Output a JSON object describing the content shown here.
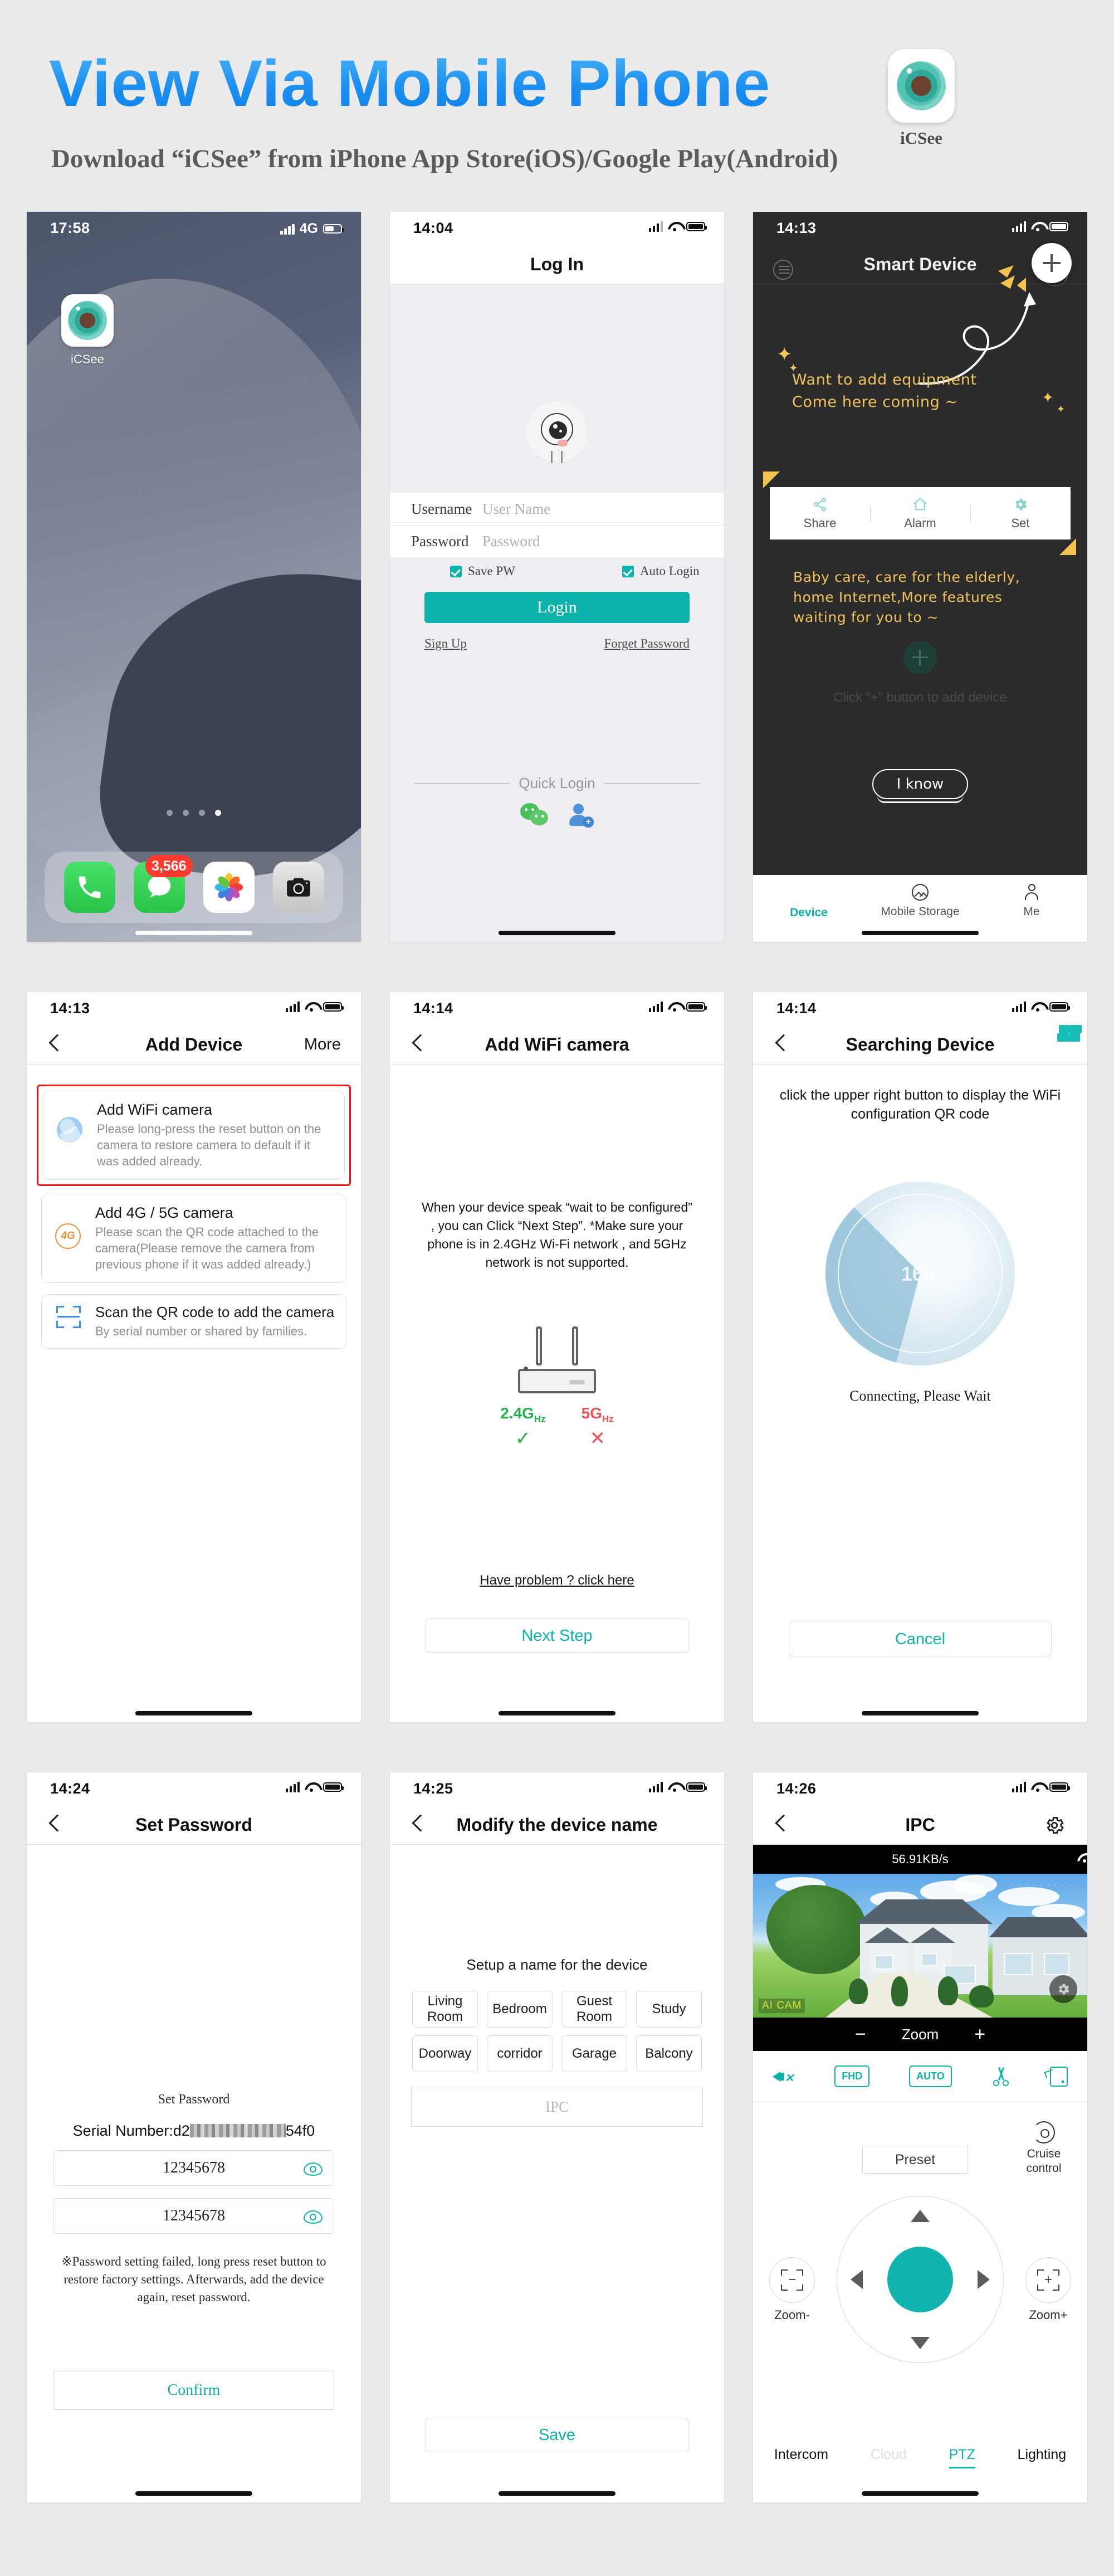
{
  "header": {
    "title": "View Via Mobile Phone",
    "subtitle": "Download “iCSee” from iPhone App Store(iOS)/Google Play(Android)",
    "app_name": "iCSee",
    "accent_blue": "#1b8ff0",
    "accent_teal": "#0bb3ab"
  },
  "screens": {
    "home": {
      "time": "17:58",
      "network": "4G",
      "app_label": "iCSee",
      "badge_count": "3,566",
      "dock": [
        "phone-icon",
        "messages-icon",
        "photos-icon",
        "camera-icon"
      ],
      "page_dots": 4,
      "active_dot": 4
    },
    "login": {
      "time": "14:04",
      "title": "Log In",
      "username_label": "Username",
      "username_placeholder": "User Name",
      "password_label": "Password",
      "password_placeholder": "Password",
      "save_pw": "Save PW",
      "auto_login": "Auto Login",
      "login_button": "Login",
      "sign_up": "Sign Up",
      "forget_password": "Forget Password",
      "quick_login": "Quick Login",
      "quick_icons": [
        "wechat-icon",
        "qq-icon"
      ]
    },
    "smart_device": {
      "time": "14:13",
      "title": "Smart Device",
      "hint_line1": "Want to add equipment",
      "hint_line2": "Come here coming ~",
      "quick_actions": [
        "Share",
        "Alarm",
        "Set"
      ],
      "hint2_line1": "Baby care, care for the elderly,",
      "hint2_line2": "home Internet,More features",
      "hint2_line3": "waiting for you to ~",
      "empty_hint": "Click “+” button to add device",
      "i_know": "I know",
      "tabs": [
        "Device",
        "Mobile Storage",
        "Me"
      ],
      "active_tab": "Device"
    },
    "add_device": {
      "time": "14:13",
      "title": "Add Device",
      "more": "More",
      "options": [
        {
          "title": "Add WiFi camera",
          "desc": "Please long-press the reset button on the camera to restore camera to default if it was added already.",
          "highlighted": true
        },
        {
          "title": "Add 4G / 5G camera",
          "desc": "Please scan the QR code attached to the camera(Please remove the camera from previous phone if it was added already.)",
          "highlighted": false
        },
        {
          "title": "Scan the QR code to add the camera",
          "desc": "By serial number or shared by families.",
          "highlighted": false
        }
      ]
    },
    "add_wifi": {
      "time": "14:14",
      "title": "Add WiFi camera",
      "paragraph": "When your device speak “wait to be configured” , you can Click “Next Step”. *Make sure your phone is in 2.4GHz Wi-Fi network , and 5GHz network is not supported.",
      "freq_ok_label": "2.4G",
      "freq_ok_unit": "Hz",
      "freq_ok_mark": "✓",
      "freq_no_label": "5G",
      "freq_no_unit": "Hz",
      "freq_no_mark": "✕",
      "have_problem": "Have problem ? click here",
      "next_step": "Next Step"
    },
    "searching": {
      "time": "14:14",
      "title": "Searching Device",
      "note": "click the upper right button to display the WiFi configuration QR code",
      "degrees": "166'",
      "status": "Connecting, Please Wait",
      "cancel": "Cancel"
    },
    "set_password": {
      "time": "14:24",
      "title": "Set Password",
      "section_title": "Set Password",
      "serial_prefix": "Serial Number:d2",
      "serial_suffix": "54f0",
      "password1": "12345678",
      "password2": "12345678",
      "warning": "※Password setting failed, long press reset button to restore factory settings. Afterwards, add the device again, reset password.",
      "confirm": "Confirm"
    },
    "modify_name": {
      "time": "14:25",
      "title": "Modify the device name",
      "prompt": "Setup a name for the device",
      "chips": [
        "Living Room",
        "Bedroom",
        "Guest Room",
        "Study",
        "Doorway",
        "corridor",
        "Garage",
        "Balcony"
      ],
      "name_placeholder": "IPC",
      "save": "Save"
    },
    "ipc": {
      "time": "14:26",
      "title": "IPC",
      "bitrate": "56.91KB/s",
      "watermark": "AI CAM",
      "zoom_label": "Zoom",
      "zoom_minus": "−",
      "zoom_plus": "+",
      "tools": [
        "mute-icon",
        "FHD",
        "AUTO",
        "scissors-icon",
        "snapshot-icon"
      ],
      "preset": "Preset",
      "cruise_line1": "Cruise",
      "cruise_line2": "control",
      "zoom_out": "Zoom-",
      "zoom_in": "Zoom+",
      "zoom_out_sign": "−",
      "zoom_in_sign": "+",
      "tabs": [
        "Intercom",
        "Cloud",
        "PTZ",
        "Lighting"
      ],
      "active_tab": "PTZ",
      "disabled_tab": "Cloud"
    }
  }
}
